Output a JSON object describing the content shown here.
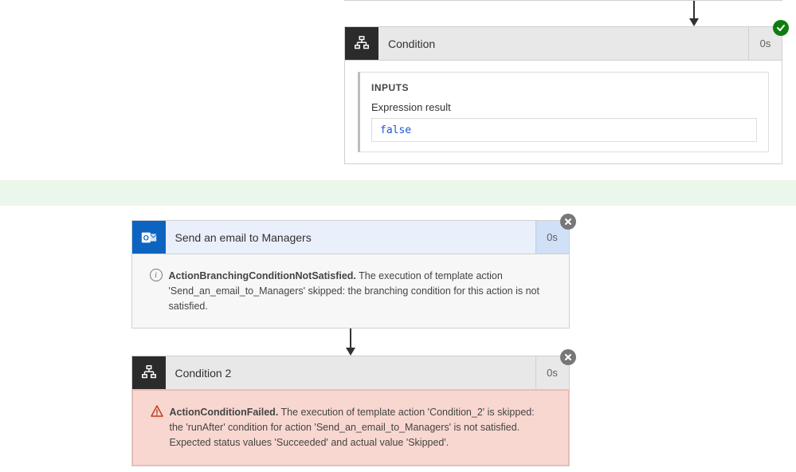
{
  "top_card": {
    "title": "Condition",
    "duration": "0s",
    "inputs_title": "INPUTS",
    "expression_label": "Expression result",
    "expression_value": "false"
  },
  "email_card": {
    "title": "Send an email to Managers",
    "duration": "0s",
    "message_bold": "ActionBranchingConditionNotSatisfied.",
    "message_rest": " The execution of template action 'Send_an_email_to_Managers' skipped: the branching condition for this action is not satisfied."
  },
  "condition2_card": {
    "title": "Condition 2",
    "duration": "0s",
    "message_bold": "ActionConditionFailed.",
    "message_rest": " The execution of template action 'Condition_2' is skipped: the 'runAfter' condition for action 'Send_an_email_to_Managers' is not satisfied. Expected status values 'Succeeded' and actual value 'Skipped'."
  }
}
